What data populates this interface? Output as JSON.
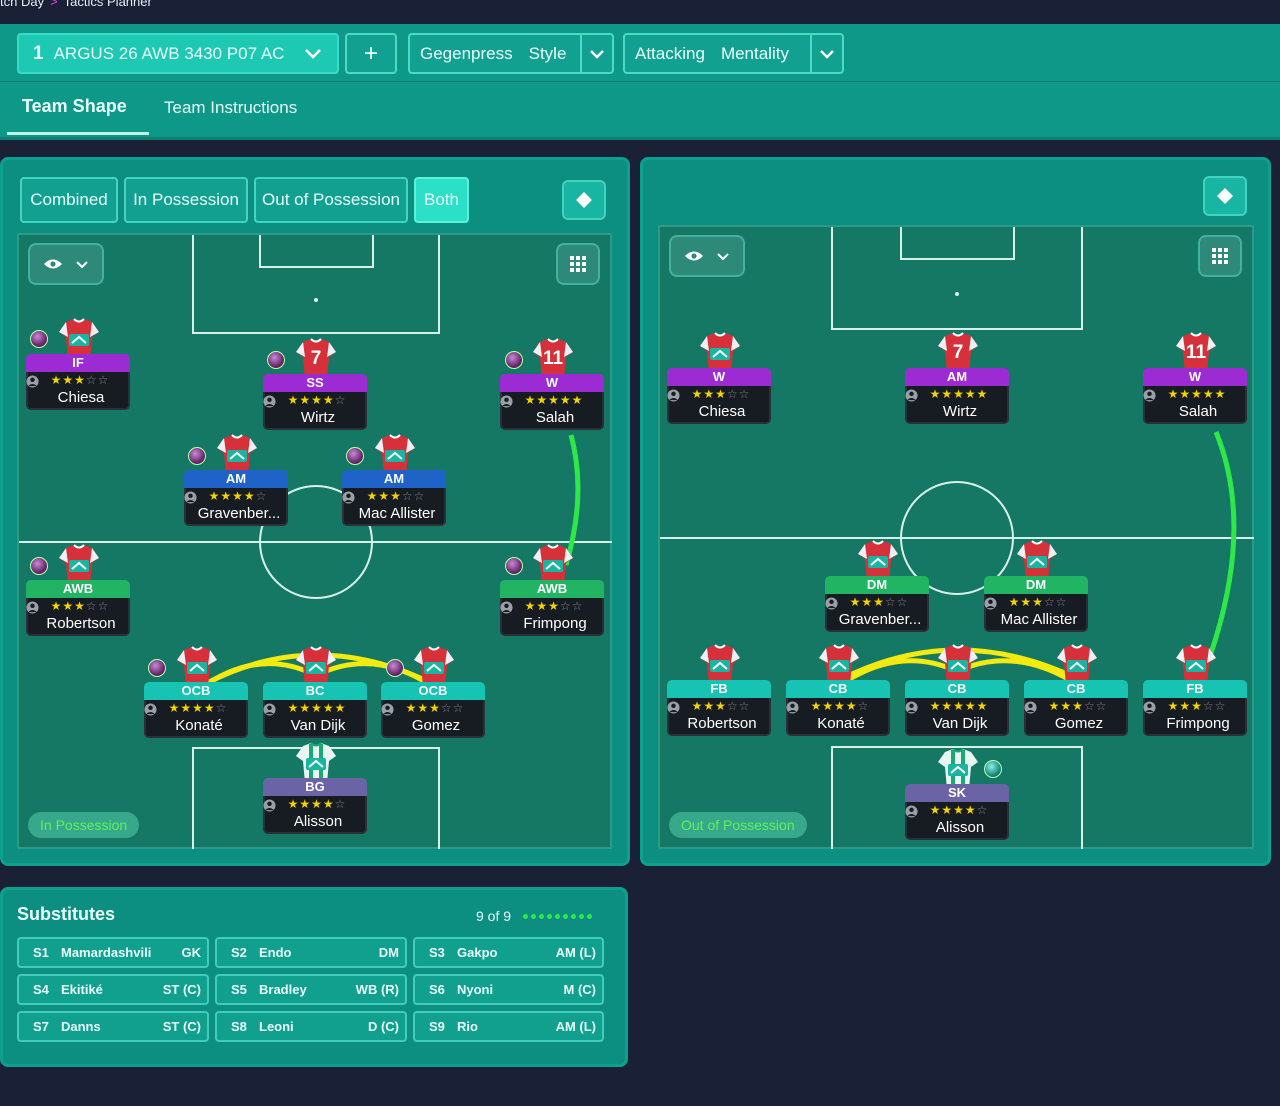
{
  "breadcrumb": {
    "parent": "tch Day",
    "current": "Tactics Planner"
  },
  "tactic": {
    "number": "1",
    "name": "ARGUS 26 AWB 3430 P07 AC",
    "add_label": "+"
  },
  "style": {
    "value": "Gegenpress",
    "label": "Style"
  },
  "mentality": {
    "value": "Attacking",
    "label": "Mentality"
  },
  "tabs": [
    {
      "label": "Team Shape"
    },
    {
      "label": "Team Instructions"
    }
  ],
  "view_modes": [
    {
      "label": "Combined"
    },
    {
      "label": "In Possession"
    },
    {
      "label": "Out of Possession"
    },
    {
      "label": "Both"
    }
  ],
  "left_pitch": {
    "phase_label": "In Possession",
    "players": [
      {
        "role": "IF",
        "number": "",
        "stars": "★★★☆☆",
        "name": "Chiesa"
      },
      {
        "role": "SS",
        "number": "7",
        "stars": "★★★★☆",
        "name": "Wirtz"
      },
      {
        "role": "W",
        "number": "11",
        "stars": "★★★★★",
        "name": "Salah"
      },
      {
        "role": "AM",
        "number": "",
        "stars": "★★★★☆",
        "name": "Gravenber..."
      },
      {
        "role": "AM",
        "number": "",
        "stars": "★★★☆☆",
        "name": "Mac Allister"
      },
      {
        "role": "AWB",
        "number": "",
        "stars": "★★★☆☆",
        "name": "Robertson"
      },
      {
        "role": "AWB",
        "number": "",
        "stars": "★★★☆☆",
        "name": "Frimpong"
      },
      {
        "role": "OCB",
        "number": "",
        "stars": "★★★★☆",
        "name": "Konaté"
      },
      {
        "role": "BC",
        "number": "",
        "stars": "★★★★★",
        "name": "Van Dijk"
      },
      {
        "role": "OCB",
        "number": "",
        "stars": "★★★☆☆",
        "name": "Gomez"
      },
      {
        "role": "BG",
        "number": "",
        "stars": "★★★★☆",
        "name": "Alisson"
      }
    ]
  },
  "right_pitch": {
    "phase_label": "Out of Possession",
    "players": [
      {
        "role": "W",
        "number": "",
        "stars": "★★★☆☆",
        "name": "Chiesa"
      },
      {
        "role": "AM",
        "number": "7",
        "stars": "★★★★★",
        "name": "Wirtz"
      },
      {
        "role": "W",
        "number": "11",
        "stars": "★★★★★",
        "name": "Salah"
      },
      {
        "role": "DM",
        "number": "",
        "stars": "★★★☆☆",
        "name": "Gravenber..."
      },
      {
        "role": "DM",
        "number": "",
        "stars": "★★★☆☆",
        "name": "Mac Allister"
      },
      {
        "role": "FB",
        "number": "",
        "stars": "★★★☆☆",
        "name": "Robertson"
      },
      {
        "role": "CB",
        "number": "",
        "stars": "★★★★☆",
        "name": "Konaté"
      },
      {
        "role": "CB",
        "number": "",
        "stars": "★★★★★",
        "name": "Van Dijk"
      },
      {
        "role": "CB",
        "number": "",
        "stars": "★★★☆☆",
        "name": "Gomez"
      },
      {
        "role": "FB",
        "number": "",
        "stars": "★★★☆☆",
        "name": "Frimpong"
      },
      {
        "role": "SK",
        "number": "",
        "stars": "★★★★☆",
        "name": "Alisson"
      }
    ]
  },
  "substitutes": {
    "title": "Substitutes",
    "count": "9 of 9",
    "items": [
      {
        "slot": "S1",
        "name": "Mamardashvili",
        "pos": "GK"
      },
      {
        "slot": "S2",
        "name": "Endo",
        "pos": "DM"
      },
      {
        "slot": "S3",
        "name": "Gakpo",
        "pos": "AM (L)"
      },
      {
        "slot": "S4",
        "name": "Ekitiké",
        "pos": "ST (C)"
      },
      {
        "slot": "S5",
        "name": "Bradley",
        "pos": "WB (R)"
      },
      {
        "slot": "S6",
        "name": "Nyoni",
        "pos": "M (C)"
      },
      {
        "slot": "S7",
        "name": "Danns",
        "pos": "ST (C)"
      },
      {
        "slot": "S8",
        "name": "Leoni",
        "pos": "D (C)"
      },
      {
        "slot": "S9",
        "name": "Rio",
        "pos": "AM (L)"
      }
    ]
  },
  "colors": {
    "accent": "#1ec9b3",
    "panel": "#0c8f80",
    "pitch": "#157864",
    "attack_role": "#9d2bd4",
    "mid_role": "#1f63c9",
    "wingback_role": "#21b463",
    "defence_role": "#17c3b2",
    "link_yellow": "#f2ea10",
    "link_green": "#2ee84a"
  }
}
